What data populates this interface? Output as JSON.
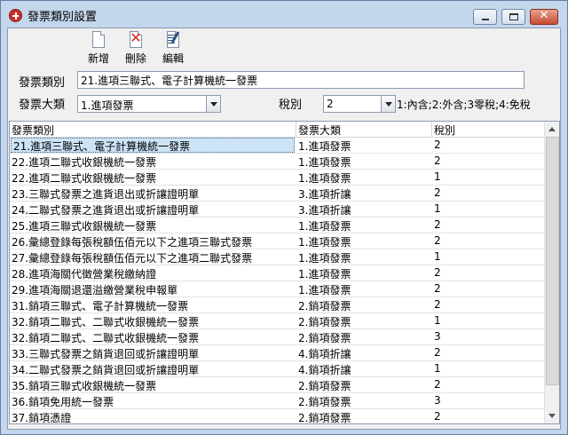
{
  "window": {
    "title": "發票類別設置",
    "minimize_label": "",
    "maximize_label": "",
    "close_label": "✕"
  },
  "toolbar": {
    "add_label": "新增",
    "delete_label": "刪除",
    "edit_label": "編輯"
  },
  "form": {
    "category_label": "發票類別",
    "category_value": "21.進項三聯式、電子計算機統一發票",
    "major_label": "發票大類",
    "major_value": "1.進項發票",
    "tax_label": "稅別",
    "tax_value": "2",
    "tax_hint": "1:內含;2:外含;3零稅;4:免稅"
  },
  "grid": {
    "columns": [
      "發票類別",
      "發票大類",
      "稅別"
    ],
    "rows": [
      [
        "21.進項三聯式、電子計算機統一發票",
        "1.進項發票",
        "2"
      ],
      [
        "22.進項二聯式收銀機統一發票",
        "1.進項發票",
        "2"
      ],
      [
        "22.進項二聯式收銀機統一發票",
        "1.進項發票",
        "1"
      ],
      [
        "23.三聯式發票之進貨退出或折讓證明單",
        "3.進項折讓",
        "2"
      ],
      [
        "24.二聯式發票之進貨退出或折讓證明單",
        "3.進項折讓",
        "1"
      ],
      [
        "25.進項三聯式收銀機統一發票",
        "1.進項發票",
        "2"
      ],
      [
        "26.彙總登錄每張稅額伍佰元以下之進項三聯式發票",
        "1.進項發票",
        "2"
      ],
      [
        "27.彙總登錄每張稅額伍佰元以下之進項二聯式發票",
        "1.進項發票",
        "1"
      ],
      [
        "28.進項海關代徵營業稅繳納證",
        "1.進項發票",
        "2"
      ],
      [
        "29.進項海關退還溢繳營業稅申報單",
        "1.進項發票",
        "2"
      ],
      [
        "31.銷項三聯式、電子計算機統一發票",
        "2.銷項發票",
        "2"
      ],
      [
        "32.銷項二聯式、二聯式收銀機統一發票",
        "2.銷項發票",
        "1"
      ],
      [
        "32.銷項二聯式、二聯式收銀機統一發票",
        "2.銷項發票",
        "3"
      ],
      [
        "33.三聯式發票之銷貨退回或折讓證明單",
        "4.銷項折讓",
        "2"
      ],
      [
        "34.二聯式發票之銷貨退回或折讓證明單",
        "4.銷項折讓",
        "1"
      ],
      [
        "35.銷項三聯式收銀機統一發票",
        "2.銷項發票",
        "2"
      ],
      [
        "36.銷項免用統一發票",
        "2.銷項發票",
        "3"
      ],
      [
        "37.銷項憑證",
        "2.銷項發票",
        "2"
      ]
    ]
  },
  "colors": {
    "frame": "#c3d6ec",
    "selection": "#cde4f7",
    "close_button": "#c74a33"
  },
  "icons": {
    "app": "app-icon",
    "add": "new-document-icon",
    "delete": "delete-x-icon",
    "edit": "edit-document-icon"
  }
}
